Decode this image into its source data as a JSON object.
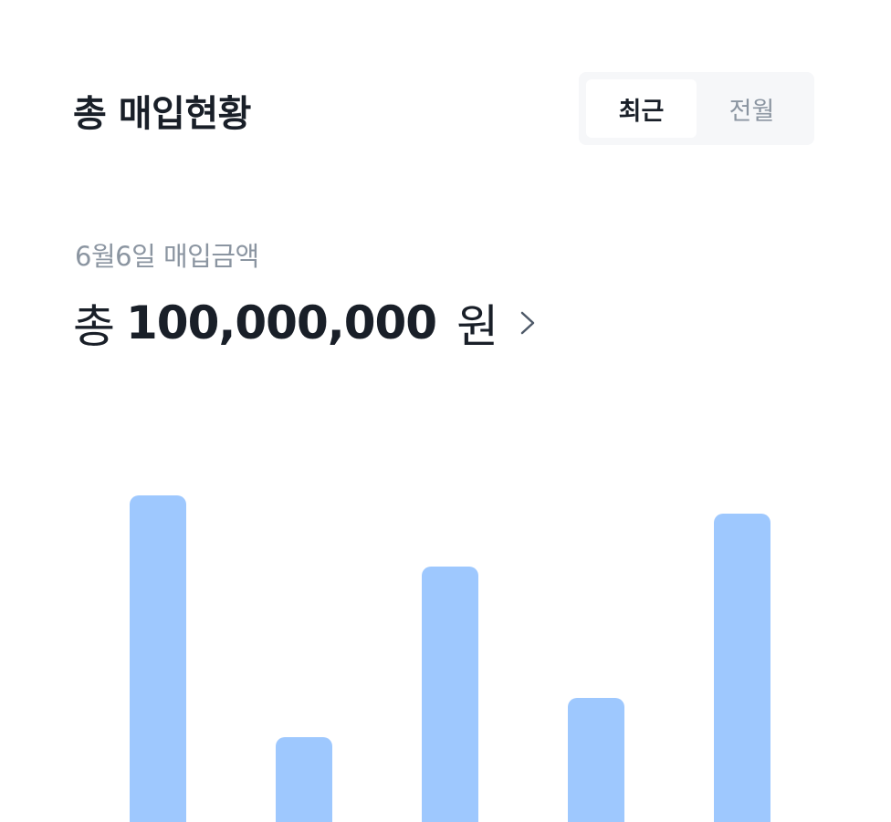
{
  "header": {
    "title": "총 매입현황"
  },
  "period_toggle": {
    "options": [
      "최근",
      "전월"
    ],
    "selected": "최근"
  },
  "summary": {
    "date_label": "6월6일 매입금액",
    "prefix": "총",
    "amount": "100,000,000",
    "unit": "원",
    "chevron_icon": "chevron-right-icon"
  },
  "colors": {
    "bar": "#9ec8fe",
    "toggle_bg": "#f6f7f9",
    "muted_text": "#8b95a1",
    "primary_text": "#191f28"
  },
  "chart_data": {
    "type": "bar",
    "categories": [
      "",
      "",
      "",
      "",
      ""
    ],
    "values": [
      358,
      93,
      280,
      136,
      338
    ],
    "title": "",
    "xlabel": "",
    "ylabel": "",
    "grid": false,
    "legend": "none"
  }
}
